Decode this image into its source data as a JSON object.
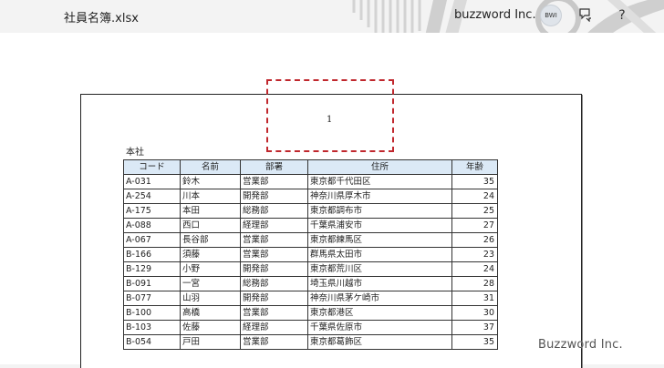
{
  "titlebar": {
    "file_name": "社員名簿.xlsx",
    "account_name": "buzzword Inc.",
    "avatar_text": "BWI",
    "help_glyph": "?",
    "feedback_icon": "feedback-icon",
    "help_icon": "help-icon"
  },
  "page": {
    "header_page_number": "1",
    "sheet_caption": "本社"
  },
  "table": {
    "headers": [
      "コード",
      "名前",
      "部署",
      "住所",
      "年齢"
    ],
    "rows": [
      [
        "A-031",
        "鈴木",
        "営業部",
        "東京都千代田区",
        "35"
      ],
      [
        "A-254",
        "川本",
        "開発部",
        "神奈川県厚木市",
        "24"
      ],
      [
        "A-175",
        "本田",
        "総務部",
        "東京都調布市",
        "25"
      ],
      [
        "A-088",
        "西口",
        "経理部",
        "千葉県浦安市",
        "27"
      ],
      [
        "A-067",
        "長谷部",
        "営業部",
        "東京都練馬区",
        "26"
      ],
      [
        "B-166",
        "須藤",
        "営業部",
        "群馬県太田市",
        "23"
      ],
      [
        "B-129",
        "小野",
        "開発部",
        "東京都荒川区",
        "24"
      ],
      [
        "B-091",
        "一宮",
        "総務部",
        "埼玉県川越市",
        "28"
      ],
      [
        "B-077",
        "山羽",
        "開発部",
        "神奈川県茅ケ崎市",
        "31"
      ],
      [
        "B-100",
        "高橋",
        "営業部",
        "東京都港区",
        "30"
      ],
      [
        "B-103",
        "佐藤",
        "経理部",
        "千葉県佐原市",
        "37"
      ],
      [
        "B-054",
        "戸田",
        "営業部",
        "東京都葛飾区",
        "35"
      ]
    ]
  },
  "watermark": "Buzzword Inc.",
  "colors": {
    "header_fill": "#dbe9f6",
    "header_box_border": "#c0272d"
  }
}
